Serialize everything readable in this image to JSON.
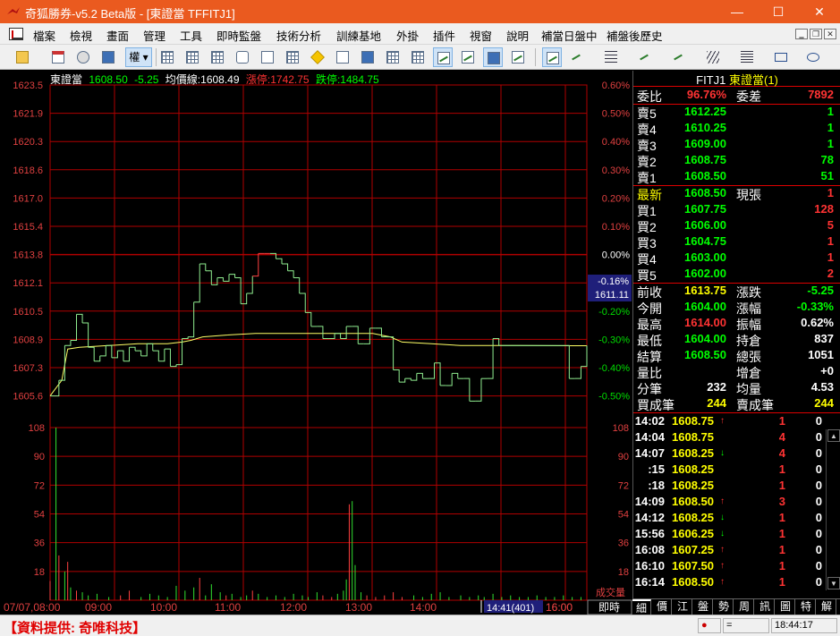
{
  "window": {
    "title": "奇狐勝券-v5.2 Beta版 - [東證當 TFFITJ1]",
    "minimize": "—",
    "maximize": "☐",
    "close": "✕"
  },
  "menu": {
    "items": [
      "檔案",
      "檢視",
      "畫面",
      "管理",
      "工具",
      "即時監盤",
      "技術分析",
      "訓練基地",
      "外掛",
      "插件",
      "視窗",
      "說明",
      "補當日盤中",
      "補盤後歷史"
    ],
    "mdi_min": "‗",
    "mdi_restore": "❐",
    "mdi_close": "✕"
  },
  "toolbar": {
    "rights_label": "權",
    "icons": [
      "open-folder-icon",
      "import-icon",
      "move-icon",
      "screen-icon",
      "rights-dropdown",
      "grid-icon",
      "grid-icon",
      "grid-icon",
      "grid-icon",
      "list-icon",
      "link-icon",
      "document-icon",
      "warning-icon",
      "screenshot-icon",
      "screenshot-icon",
      "table-icon",
      "line-chart-icon",
      "trend-chart-icon",
      "window-chart-icon",
      "edit-chart-icon",
      "draw-pen-icon",
      "line-tool-icon",
      "fib-tool-icon",
      "parallel-tool-icon",
      "fan-tool-icon",
      "channel-tool-icon",
      "rectangle-tool-icon",
      "ellipse-tool-icon"
    ]
  },
  "chart_header": {
    "name": "東證當",
    "last": "1608.50",
    "change": "-5.25",
    "avg_label": "均價線:",
    "avg_value": "1608.49",
    "limit_up_label": "漲停:",
    "limit_up": "1742.75",
    "limit_down_label": "跌停:",
    "limit_down": "1484.75"
  },
  "chart_data": {
    "type": "line",
    "price_axis_labels": [
      "1623.5",
      "1621.9",
      "1620.3",
      "1618.6",
      "1617.0",
      "1615.4",
      "1613.8",
      "1612.1",
      "1610.5",
      "1608.9",
      "1607.3",
      "1605.6"
    ],
    "percent_axis_labels": [
      "0.60%",
      "0.50%",
      "0.40%",
      "0.30%",
      "0.20%",
      "0.10%",
      "0.00%",
      "-0.10%",
      "-0.20%",
      "-0.30%",
      "-0.40%",
      "-0.50%"
    ],
    "reference_price": 1613.75,
    "price_ylim": [
      1604.0,
      1623.5
    ],
    "time_labels": [
      "07/07,08:00",
      "09:00",
      "10:00",
      "11:00",
      "12:00",
      "13:00",
      "14:00",
      "15:00",
      "16:00"
    ],
    "cursor_price": "1611.11",
    "cursor_percent": "-0.16%",
    "cursor_time": "14:41(401)",
    "volume_axis_labels": [
      "108",
      "90",
      "72",
      "54",
      "36",
      "18"
    ],
    "volume_label": "成交量",
    "volume_ylim": [
      0,
      108
    ],
    "mode_label": "即時",
    "price_series": {
      "name": "東證當",
      "color": "#7cfc7c",
      "points": [
        [
          0,
          1605.6
        ],
        [
          3,
          1606.5
        ],
        [
          5,
          1608.5
        ],
        [
          7,
          1608.8
        ],
        [
          9,
          1610.3
        ],
        [
          11,
          1609.8
        ],
        [
          13,
          1608.4
        ],
        [
          15,
          1607.6
        ],
        [
          17,
          1607.9
        ],
        [
          19,
          1608.5
        ],
        [
          21,
          1607.8
        ],
        [
          23,
          1608.2
        ],
        [
          25,
          1607.6
        ],
        [
          27,
          1608.4
        ],
        [
          29,
          1608.2
        ],
        [
          31,
          1607.9
        ],
        [
          33,
          1608.6
        ],
        [
          35,
          1608.2
        ],
        [
          37,
          1607.6
        ],
        [
          39,
          1608.3
        ],
        [
          41,
          1607.3
        ],
        [
          43,
          1607.4
        ],
        [
          45,
          1608.9
        ],
        [
          47,
          1609.0
        ],
        [
          49,
          1611.0
        ],
        [
          51,
          1613.2
        ],
        [
          53,
          1612.8
        ],
        [
          55,
          1612.0
        ],
        [
          57,
          1612.4
        ],
        [
          59,
          1612.2
        ],
        [
          61,
          1612.6
        ],
        [
          63,
          1612.4
        ],
        [
          65,
          1610.9
        ],
        [
          67,
          1611.5
        ],
        [
          69,
          1612.5
        ],
        [
          71,
          1613.8
        ],
        [
          73,
          1613.8
        ],
        [
          75,
          1613.8
        ],
        [
          77,
          1613.5
        ],
        [
          79,
          1613.2
        ],
        [
          81,
          1612.8
        ],
        [
          83,
          1612.4
        ],
        [
          85,
          1611.5
        ],
        [
          87,
          1610.4
        ],
        [
          89,
          1609.6
        ],
        [
          91,
          1609.6
        ],
        [
          93,
          1608.9
        ],
        [
          95,
          1608.9
        ],
        [
          97,
          1609.2
        ],
        [
          99,
          1608.9
        ],
        [
          101,
          1609.6
        ],
        [
          103,
          1609.6
        ],
        [
          105,
          1608.6
        ],
        [
          107,
          1608.6
        ],
        [
          109,
          1609.5
        ],
        [
          111,
          1609.5
        ],
        [
          113,
          1609.0
        ],
        [
          115,
          1609.0
        ],
        [
          117,
          1607.1
        ],
        [
          119,
          1606.4
        ],
        [
          121,
          1606.6
        ],
        [
          123,
          1606.5
        ],
        [
          125,
          1606.9
        ],
        [
          127,
          1606.6
        ],
        [
          129,
          1606.6
        ],
        [
          131,
          1607.5
        ],
        [
          133,
          1606.2
        ],
        [
          135,
          1606.2
        ],
        [
          137,
          1606.9
        ],
        [
          139,
          1606.6
        ],
        [
          141,
          1606.6
        ],
        [
          143,
          1605.3
        ],
        [
          145,
          1605.3
        ],
        [
          147,
          1606.6
        ],
        [
          149,
          1606.6
        ],
        [
          151,
          1608.9
        ],
        [
          153,
          1608.5
        ],
        [
          155,
          1608.5
        ],
        [
          157,
          1608.5
        ],
        [
          159,
          1608.5
        ],
        [
          161,
          1608.5
        ],
        [
          163,
          1608.5
        ],
        [
          165,
          1608.5
        ],
        [
          167,
          1608.5
        ],
        [
          169,
          1608.5
        ],
        [
          171,
          1608.5
        ],
        [
          173,
          1608.5
        ],
        [
          175,
          1608.5
        ],
        [
          177,
          1606.6
        ],
        [
          179,
          1606.6
        ],
        [
          181,
          1607.3
        ],
        [
          183,
          1608.5
        ]
      ]
    },
    "avg_series": {
      "name": "均價線",
      "color": "#ffff66",
      "points": [
        [
          0,
          1605.6
        ],
        [
          4,
          1606.5
        ],
        [
          6,
          1608.3
        ],
        [
          10,
          1608.4
        ],
        [
          20,
          1608.5
        ],
        [
          30,
          1608.6
        ],
        [
          40,
          1608.6
        ],
        [
          45,
          1608.7
        ],
        [
          48,
          1608.8
        ],
        [
          52,
          1609.0
        ],
        [
          60,
          1609.1
        ],
        [
          70,
          1609.2
        ],
        [
          80,
          1609.2
        ],
        [
          90,
          1609.2
        ],
        [
          100,
          1609.2
        ],
        [
          110,
          1609.2
        ],
        [
          116,
          1609.0
        ],
        [
          120,
          1608.7
        ],
        [
          130,
          1608.6
        ],
        [
          140,
          1608.5
        ],
        [
          150,
          1608.5
        ],
        [
          160,
          1608.5
        ],
        [
          183,
          1608.49
        ]
      ]
    },
    "volume_bars": [
      [
        0,
        12
      ],
      [
        2,
        108
      ],
      [
        3,
        28
      ],
      [
        5,
        18
      ],
      [
        6,
        24
      ],
      [
        7,
        8
      ],
      [
        9,
        6
      ],
      [
        11,
        5
      ],
      [
        13,
        3
      ],
      [
        16,
        4
      ],
      [
        20,
        2
      ],
      [
        24,
        3
      ],
      [
        27,
        6
      ],
      [
        31,
        2
      ],
      [
        34,
        4
      ],
      [
        37,
        3
      ],
      [
        40,
        2
      ],
      [
        43,
        9
      ],
      [
        46,
        6
      ],
      [
        49,
        8
      ],
      [
        51,
        14
      ],
      [
        53,
        3
      ],
      [
        55,
        10
      ],
      [
        58,
        5
      ],
      [
        60,
        3
      ],
      [
        62,
        4
      ],
      [
        65,
        2
      ],
      [
        67,
        3
      ],
      [
        69,
        6
      ],
      [
        71,
        4
      ],
      [
        74,
        2
      ],
      [
        77,
        3
      ],
      [
        80,
        2
      ],
      [
        83,
        4
      ],
      [
        86,
        3
      ],
      [
        88,
        2
      ],
      [
        91,
        5
      ],
      [
        93,
        3
      ],
      [
        96,
        2
      ],
      [
        98,
        4
      ],
      [
        100,
        6
      ],
      [
        101,
        13
      ],
      [
        102,
        60
      ],
      [
        103,
        62
      ],
      [
        104,
        22
      ],
      [
        106,
        5
      ],
      [
        108,
        3
      ],
      [
        111,
        2
      ],
      [
        114,
        3
      ],
      [
        117,
        5
      ],
      [
        120,
        2
      ],
      [
        124,
        3
      ],
      [
        127,
        2
      ],
      [
        130,
        4
      ],
      [
        133,
        5
      ],
      [
        136,
        2
      ],
      [
        140,
        3
      ],
      [
        143,
        2
      ],
      [
        146,
        3
      ],
      [
        148,
        2
      ],
      [
        151,
        4
      ],
      [
        154,
        2
      ],
      [
        157,
        3
      ],
      [
        160,
        2
      ],
      [
        163,
        2
      ],
      [
        166,
        3
      ],
      [
        169,
        2
      ],
      [
        172,
        2
      ],
      [
        175,
        3
      ],
      [
        178,
        2
      ],
      [
        181,
        2
      ]
    ]
  },
  "quote": {
    "symbol": "FITJ1",
    "name": "東證當(1)",
    "ratio_label": "委比",
    "ratio": "96.76%",
    "diff_label": "委差",
    "diff": "7892",
    "asks": [
      {
        "label": "賣5",
        "price": "1612.25",
        "qty": "1"
      },
      {
        "label": "賣4",
        "price": "1610.25",
        "qty": "1"
      },
      {
        "label": "賣3",
        "price": "1609.00",
        "qty": "1"
      },
      {
        "label": "賣2",
        "price": "1608.75",
        "qty": "78"
      },
      {
        "label": "賣1",
        "price": "1608.50",
        "qty": "51"
      }
    ],
    "last_label": "最新",
    "last": "1608.50",
    "now_qty_label": "現張",
    "now_qty": "1",
    "bids": [
      {
        "label": "買1",
        "price": "1607.75",
        "qty": "128"
      },
      {
        "label": "買2",
        "price": "1606.00",
        "qty": "5"
      },
      {
        "label": "買3",
        "price": "1604.75",
        "qty": "1"
      },
      {
        "label": "買4",
        "price": "1603.00",
        "qty": "1"
      },
      {
        "label": "買5",
        "price": "1602.00",
        "qty": "2"
      }
    ],
    "stats": [
      {
        "l": "前收",
        "v": "1613.75",
        "vc": "#ff0",
        "l2": "漲跌",
        "v2": "-5.25",
        "v2c": "#0f0"
      },
      {
        "l": "今開",
        "v": "1604.00",
        "vc": "#0f0",
        "l2": "漲幅",
        "v2": "-0.33%",
        "v2c": "#0f0"
      },
      {
        "l": "最高",
        "v": "1614.00",
        "vc": "#f33",
        "l2": "振幅",
        "v2": "0.62%",
        "v2c": "#fff"
      },
      {
        "l": "最低",
        "v": "1604.00",
        "vc": "#0f0",
        "l2": "持倉",
        "v2": "837",
        "v2c": "#fff"
      },
      {
        "l": "結算",
        "v": "1608.50",
        "vc": "#0f0",
        "l2": "總張",
        "v2": "1051",
        "v2c": "#fff"
      },
      {
        "l": "量比",
        "v": "",
        "vc": "#fff",
        "l2": "增倉",
        "v2": "+0",
        "v2c": "#fff"
      },
      {
        "l": "分筆",
        "v": "232",
        "vc": "#fff",
        "l2": "均量",
        "v2": "4.53",
        "v2c": "#fff"
      },
      {
        "l": "買成筆",
        "v": "244",
        "vc": "#ff0",
        "l2": "賣成筆",
        "v2": "244",
        "v2c": "#ff0"
      }
    ],
    "ticks": [
      {
        "t": "14:02",
        "p": "1608.75",
        "a": "↑",
        "ac": "#f33",
        "v": "1",
        "z": "0"
      },
      {
        "t": "14:04",
        "p": "1608.75",
        "a": "",
        "ac": "#fff",
        "v": "4",
        "z": "0"
      },
      {
        "t": "14:07",
        "p": "1608.25",
        "a": "↓",
        "ac": "#0f0",
        "v": "4",
        "z": "0"
      },
      {
        "t": ":15",
        "p": "1608.25",
        "a": "",
        "ac": "#fff",
        "v": "1",
        "z": "0"
      },
      {
        "t": ":18",
        "p": "1608.25",
        "a": "",
        "ac": "#fff",
        "v": "1",
        "z": "0"
      },
      {
        "t": "14:09",
        "p": "1608.50",
        "a": "↑",
        "ac": "#f33",
        "v": "3",
        "z": "0"
      },
      {
        "t": "14:12",
        "p": "1608.25",
        "a": "↓",
        "ac": "#0f0",
        "v": "1",
        "z": "0"
      },
      {
        "t": "15:56",
        "p": "1606.25",
        "a": "↓",
        "ac": "#0f0",
        "v": "1",
        "z": "0"
      },
      {
        "t": "16:08",
        "p": "1607.25",
        "a": "↑",
        "ac": "#f33",
        "v": "1",
        "z": "0"
      },
      {
        "t": "16:10",
        "p": "1607.50",
        "a": "↑",
        "ac": "#f33",
        "v": "1",
        "z": "0"
      },
      {
        "t": "16:14",
        "p": "1608.50",
        "a": "↑",
        "ac": "#f33",
        "v": "1",
        "z": "0"
      }
    ],
    "tabs": [
      "細",
      "價",
      "江",
      "盤",
      "勢",
      "周",
      "訊",
      "圖",
      "特",
      "解"
    ]
  },
  "status": {
    "provider": "【資料提供: 奇唯科技】",
    "equal": "=",
    "time": "18:44:17"
  },
  "colors": {
    "title_bar": "#ea5a1f",
    "grid": "#b00000",
    "up": "#ff3333",
    "down": "#00ff00",
    "flat": "#ffff00"
  }
}
